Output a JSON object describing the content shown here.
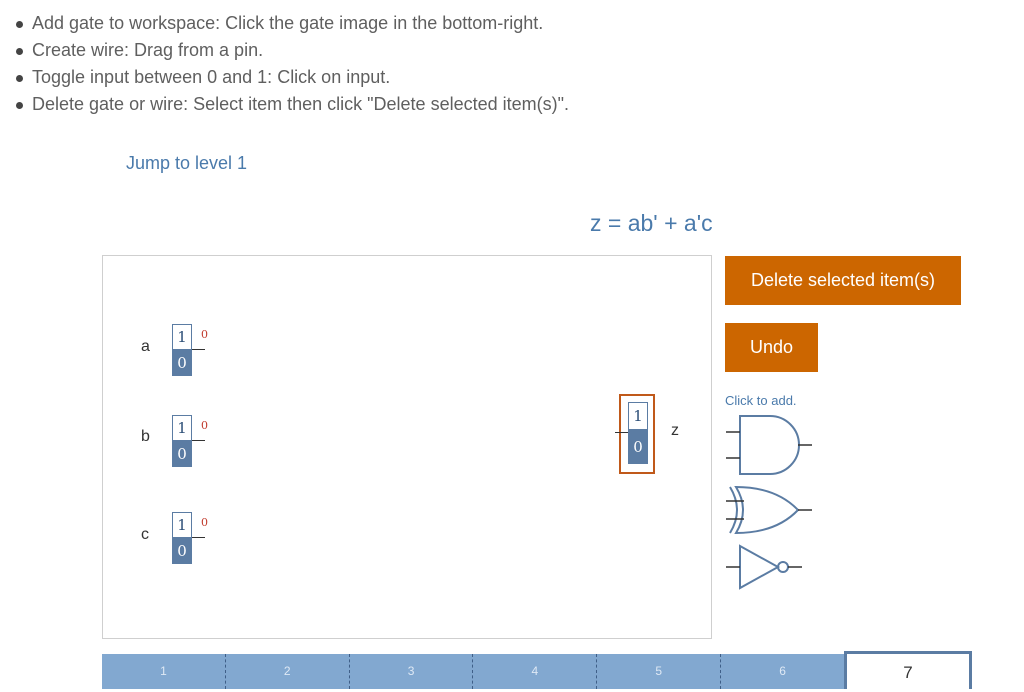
{
  "instructions": [
    "Add gate to workspace: Click the gate image in the bottom-right.",
    "Create wire: Drag from a pin.",
    "Toggle input between 0 and 1: Click on input.",
    "Delete gate or wire: Select item then click \"Delete selected item(s)\"."
  ],
  "jump_link": "Jump to level 1",
  "expression": "z = ab' + a'c",
  "inputs": [
    {
      "label": "a",
      "top": "1",
      "bottom": "0",
      "value": "0"
    },
    {
      "label": "b",
      "top": "1",
      "bottom": "0",
      "value": "0"
    },
    {
      "label": "c",
      "top": "1",
      "bottom": "0",
      "value": "0"
    }
  ],
  "output": {
    "label": "z",
    "top": "1",
    "bottom": "0"
  },
  "buttons": {
    "delete": "Delete selected item(s)",
    "undo": "Undo"
  },
  "gate_palette": {
    "hint": "Click to add.",
    "gates": [
      "and-gate-icon",
      "or-gate-icon",
      "not-gate-icon"
    ]
  },
  "levels": [
    "1",
    "2",
    "3",
    "4",
    "5",
    "6",
    "7"
  ],
  "colors": {
    "accent": "#cc6600",
    "input_fill": "#5b7ca3",
    "link": "#4a7aab",
    "selected_border": "#c0591a"
  }
}
